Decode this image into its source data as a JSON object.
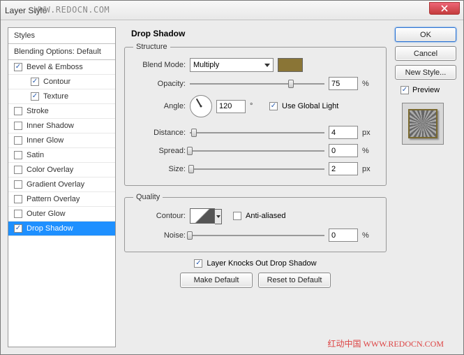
{
  "window": {
    "title": "Layer Style"
  },
  "watermark_top": "WWW.REDOCN.COM",
  "watermark_bottom": "红动中国 WWW.REDOCN.COM",
  "styles": {
    "header": "Styles",
    "blending": "Blending Options: Default",
    "items": [
      {
        "label": "Bevel & Emboss",
        "checked": true,
        "indent": false
      },
      {
        "label": "Contour",
        "checked": true,
        "indent": true
      },
      {
        "label": "Texture",
        "checked": true,
        "indent": true
      },
      {
        "label": "Stroke",
        "checked": false,
        "indent": false
      },
      {
        "label": "Inner Shadow",
        "checked": false,
        "indent": false
      },
      {
        "label": "Inner Glow",
        "checked": false,
        "indent": false
      },
      {
        "label": "Satin",
        "checked": false,
        "indent": false
      },
      {
        "label": "Color Overlay",
        "checked": false,
        "indent": false
      },
      {
        "label": "Gradient Overlay",
        "checked": false,
        "indent": false
      },
      {
        "label": "Pattern Overlay",
        "checked": false,
        "indent": false
      },
      {
        "label": "Outer Glow",
        "checked": false,
        "indent": false
      },
      {
        "label": "Drop Shadow",
        "checked": true,
        "indent": false,
        "selected": true
      }
    ]
  },
  "panel": {
    "title": "Drop Shadow",
    "structure": {
      "legend": "Structure",
      "blend_mode_label": "Blend Mode:",
      "blend_mode_value": "Multiply",
      "color": "#8a7536",
      "opacity_label": "Opacity:",
      "opacity_value": "75",
      "opacity_unit": "%",
      "angle_label": "Angle:",
      "angle_value": "120",
      "angle_unit": "°",
      "use_global_label": "Use Global Light",
      "use_global_checked": true,
      "distance_label": "Distance:",
      "distance_value": "4",
      "distance_unit": "px",
      "spread_label": "Spread:",
      "spread_value": "0",
      "spread_unit": "%",
      "size_label": "Size:",
      "size_value": "2",
      "size_unit": "px"
    },
    "quality": {
      "legend": "Quality",
      "contour_label": "Contour:",
      "anti_alias_label": "Anti-aliased",
      "anti_alias_checked": false,
      "noise_label": "Noise:",
      "noise_value": "0",
      "noise_unit": "%"
    },
    "knockout_label": "Layer Knocks Out Drop Shadow",
    "knockout_checked": true,
    "make_default": "Make Default",
    "reset_default": "Reset to Default"
  },
  "buttons": {
    "ok": "OK",
    "cancel": "Cancel",
    "new_style": "New Style...",
    "preview": "Preview",
    "preview_checked": true
  }
}
